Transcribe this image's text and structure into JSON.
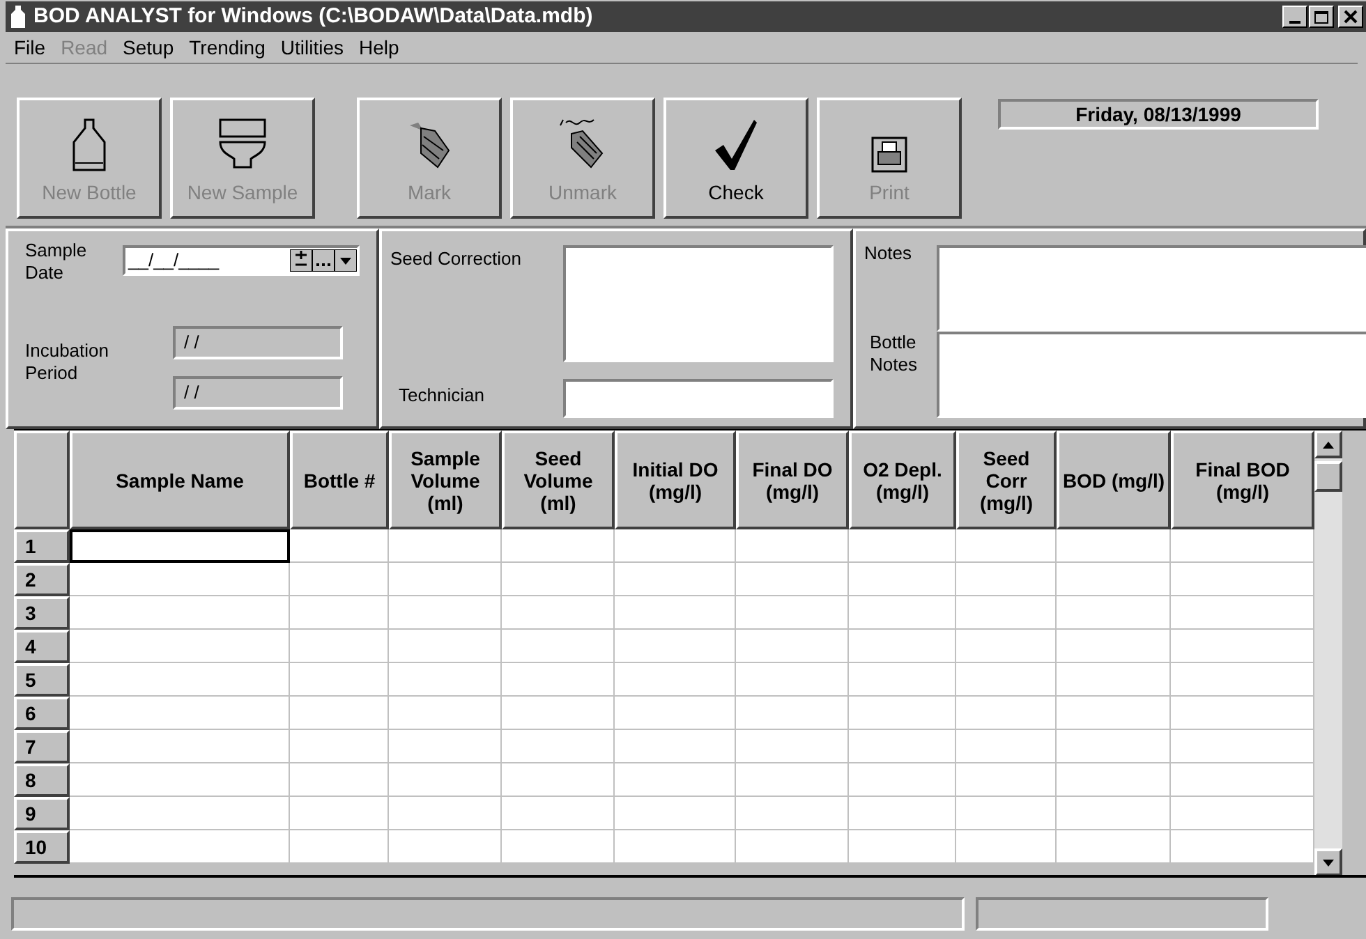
{
  "window": {
    "title": "BOD ANALYST for Windows (C:\\BODAW\\Data\\Data.mdb)"
  },
  "menu": [
    {
      "label": "File",
      "disabled": false
    },
    {
      "label": "Read",
      "disabled": true
    },
    {
      "label": "Setup",
      "disabled": false
    },
    {
      "label": "Trending",
      "disabled": false
    },
    {
      "label": "Utilities",
      "disabled": false
    },
    {
      "label": "Help",
      "disabled": false
    }
  ],
  "toolbar": [
    {
      "kind": "bottle",
      "label": "New Bottle",
      "disabled": true
    },
    {
      "kind": "sample",
      "label": "New Sample",
      "disabled": true
    },
    {
      "kind": "mark",
      "label": "Mark",
      "disabled": true
    },
    {
      "kind": "unmark",
      "label": "Unmark",
      "disabled": true
    },
    {
      "kind": "check",
      "label": "Check",
      "disabled": false
    },
    {
      "kind": "print",
      "label": "Print",
      "disabled": true
    }
  ],
  "date_display": "Friday, 08/13/1999",
  "sample_panel": {
    "sample_date_label": "Sample Date",
    "sample_date_value": "__/__/____",
    "incubation_label": "Incubation Period",
    "incubation_start": "/ /",
    "incubation_end": "/ /"
  },
  "seed_panel": {
    "seed_correction_label": "Seed Correction",
    "technician_label": "Technician"
  },
  "notes_panel": {
    "notes_label": "Notes",
    "bottle_notes_label": "Bottle Notes"
  },
  "grid": {
    "columns": [
      "Sample Name",
      "Bottle #",
      "Sample Volume (ml)",
      "Seed Volume (ml)",
      "Initial DO (mg/l)",
      "Final DO (mg/l)",
      "O2 Depl. (mg/l)",
      "Seed Corr (mg/l)",
      "BOD (mg/l)",
      "Final BOD (mg/l)"
    ],
    "rows": [
      {
        "number": "1",
        "selected": true
      },
      {
        "number": "2",
        "selected": false
      },
      {
        "number": "3",
        "selected": false
      },
      {
        "number": "4",
        "selected": false
      },
      {
        "number": "5",
        "selected": false
      },
      {
        "number": "6",
        "selected": false
      },
      {
        "number": "7",
        "selected": false
      },
      {
        "number": "8",
        "selected": false
      },
      {
        "number": "9",
        "selected": false
      },
      {
        "number": "10",
        "selected": false
      }
    ]
  }
}
